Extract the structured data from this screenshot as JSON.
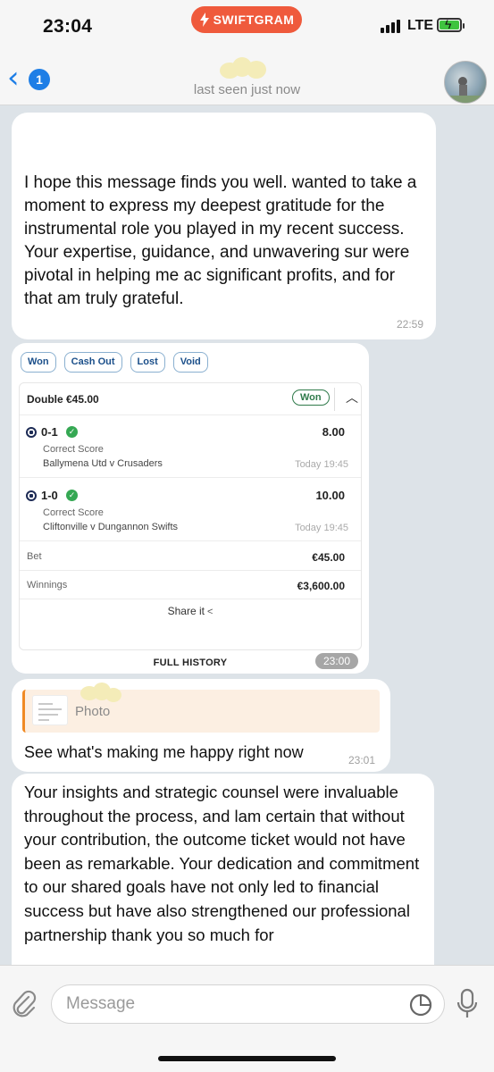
{
  "status_bar": {
    "time": "23:04",
    "app_badge": "SWIFTGRAM",
    "network": "LTE",
    "colors": {
      "badge": "#ef5a3c",
      "battery": "#3fc43f"
    }
  },
  "header": {
    "back_icon": "chevron-left-icon",
    "unread_count": "1",
    "last_seen": "last seen just now",
    "accent": "#1e7ee6"
  },
  "messages": [
    {
      "text": "I hope this message finds you well. wanted to take a moment to express my deepest gratitude for the instrumental role you played in my recent success.\nYour expertise, guidance, and unwavering sur were pivotal in helping me ac significant profits, and for that am truly grateful.",
      "time": "22:59"
    },
    {
      "bet_slip": {
        "tabs": [
          "Won",
          "Cash Out",
          "Lost",
          "Void"
        ],
        "title": "Double €45.00",
        "status": "Won",
        "selections": [
          {
            "score": "0-1",
            "odds": "8.00",
            "market": "Correct Score",
            "match": "Ballymena Utd v Crusaders",
            "when": "Today 19:45"
          },
          {
            "score": "1-0",
            "odds": "10.00",
            "market": "Correct Score",
            "match": "Cliftonville v Dungannon Swifts",
            "when": "Today 19:45"
          }
        ],
        "bet_label": "Bet",
        "bet_value": "€45.00",
        "winnings_label": "Winnings",
        "winnings_value": "€3,600.00",
        "share_label": "Share it",
        "full_history": "FULL HISTORY"
      },
      "time": "23:00"
    },
    {
      "reply_label": "Photo",
      "text": "See what's making me happy right now",
      "time": "23:01"
    },
    {
      "text": "Your insights and strategic counsel were invaluable throughout the process, and lam certain that without your contribution, the outcome ticket would not have been as remarkable. Your dedication and commitment to our shared goals have not only led to financial success but have also strengthened our professional partnership thank you so much for"
    }
  ],
  "composer": {
    "placeholder": "Message",
    "icons": [
      "paperclip-icon",
      "sticker-icon",
      "microphone-icon"
    ]
  }
}
